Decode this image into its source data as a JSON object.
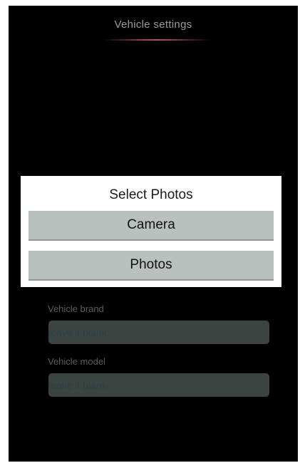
{
  "header": {
    "title": "Vehicle settings"
  },
  "form": {
    "brand": {
      "label": "Vehicle brand",
      "placeholder": "leave it blank"
    },
    "model": {
      "label": "Vehicle model",
      "placeholder": "leave it blank"
    }
  },
  "dialog": {
    "title": "Select Photos",
    "options": [
      {
        "label": "Camera"
      },
      {
        "label": "Photos"
      }
    ]
  },
  "colors": {
    "background": "#000000",
    "dialog_background": "#ffffff",
    "button_background": "#b9c1bf",
    "input_background": "#3b4440",
    "accent_underline": "#b04a7c"
  }
}
